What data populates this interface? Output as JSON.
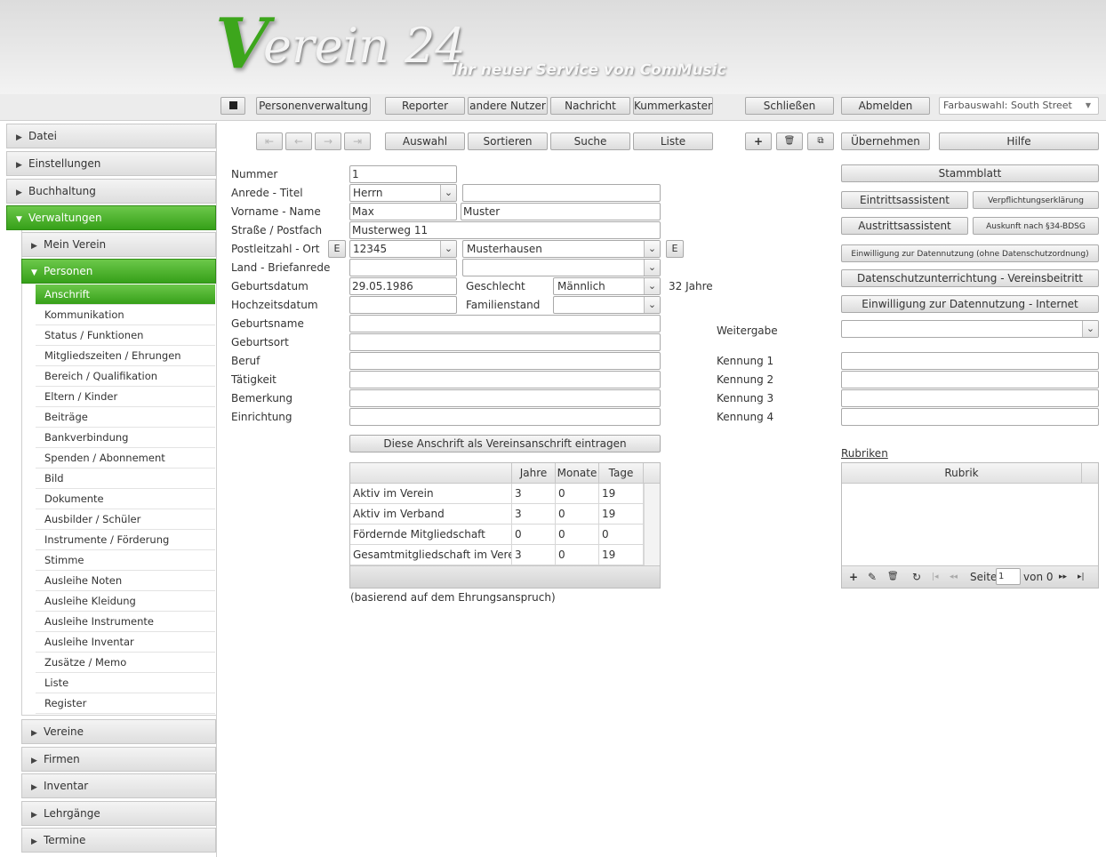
{
  "header": {
    "logo_v": "V",
    "logo_rest": "erein 24",
    "slogan": "Ihr neuer Service von ComMusic"
  },
  "toolbar": {
    "personen": "Personenverwaltung",
    "reporter": "Reporter",
    "andere": "andere Nutzer",
    "nachricht": "Nachricht",
    "kummer": "Kummerkasten",
    "schliessen": "Schließen",
    "abmelden": "Abmelden",
    "farbauswahl": "Farbauswahl: South Street"
  },
  "nav": {
    "top": [
      "Datei",
      "Einstellungen",
      "Buchhaltung",
      "Verwaltungen"
    ],
    "verw": [
      "Mein Verein",
      "Personen"
    ],
    "personen_items": [
      "Anschrift",
      "Kommunikation",
      "Status / Funktionen",
      "Mitgliedszeiten / Ehrungen",
      "Bereich / Qualifikation",
      "Eltern / Kinder",
      "Beiträge",
      "Bankverbindung",
      "Spenden / Abonnement",
      "Bild",
      "Dokumente",
      "Ausbilder / Schüler",
      "Instrumente / Förderung",
      "Stimme",
      "Ausleihe Noten",
      "Ausleihe Kleidung",
      "Ausleihe Instrumente",
      "Ausleihe Inventar",
      "Zusätze / Memo",
      "Liste",
      "Register"
    ],
    "bottom": [
      "Vereine",
      "Firmen",
      "Inventar",
      "Lehrgänge",
      "Termine"
    ]
  },
  "actions": {
    "auswahl": "Auswahl",
    "sortieren": "Sortieren",
    "suche": "Suche",
    "liste": "Liste",
    "uebernehmen": "Übernehmen",
    "hilfe": "Hilfe"
  },
  "form": {
    "labels": {
      "nummer": "Nummer",
      "anrede": "Anrede - Titel",
      "vorname": "Vorname - Name",
      "strasse": "Straße / Postfach",
      "plz": "Postleitzahl - Ort",
      "land": "Land - Briefanrede",
      "geburtsdatum": "Geburtsdatum",
      "hochzeit": "Hochzeitsdatum",
      "geburtsname": "Geburtsname",
      "geburtsort": "Geburtsort",
      "beruf": "Beruf",
      "taetigkeit": "Tätigkeit",
      "bemerkung": "Bemerkung",
      "einrichtung": "Einrichtung",
      "geschlecht": "Geschlecht",
      "familienstand": "Familienstand",
      "weitergabe": "Weitergabe",
      "kennung1": "Kennung 1",
      "kennung2": "Kennung 2",
      "kennung3": "Kennung 3",
      "kennung4": "Kennung 4"
    },
    "values": {
      "nummer": "1",
      "anrede": "Herrn",
      "vorname": "Max",
      "name": "Muster",
      "strasse": "Musterweg 11",
      "plz": "12345",
      "ort": "Musterhausen",
      "geburtsdatum": "29.05.1986",
      "geschlecht": "Männlich",
      "alter": "32 Jahre"
    },
    "e": "E",
    "vereinsanschrift": "Diese Anschrift als Vereinsanschrift eintragen",
    "note": "(basierend auf dem Ehrungsanspruch)"
  },
  "right": {
    "stammblatt": "Stammblatt",
    "eintritt": "Eintrittsassistent",
    "verpflichtung": "Verpflichtungserklärung",
    "austritt": "Austrittsassistent",
    "auskunft": "Auskunft nach §34-BDSG",
    "einwilligung1": "Einwilligung zur Datennutzung (ohne Datenschutzordnung)",
    "datenschutz": "Datenschutzunterrichtung - Vereinsbeitritt",
    "einwilligung2": "Einwilligung zur Datennutzung - Internet",
    "rubriken": "Rubriken",
    "rubrik": "Rubrik",
    "seite": "Seite",
    "seite_val": "1",
    "von": "von 0"
  },
  "table": {
    "headers": [
      "Jahre",
      "Monate",
      "Tage"
    ],
    "rows": [
      [
        "Aktiv im Verein",
        "3",
        "0",
        "19"
      ],
      [
        "Aktiv im Verband",
        "3",
        "0",
        "19"
      ],
      [
        "Fördernde Mitgliedschaft",
        "0",
        "0",
        "0"
      ],
      [
        "Gesamtmitgliedschaft im Verein",
        "3",
        "0",
        "19"
      ]
    ]
  }
}
